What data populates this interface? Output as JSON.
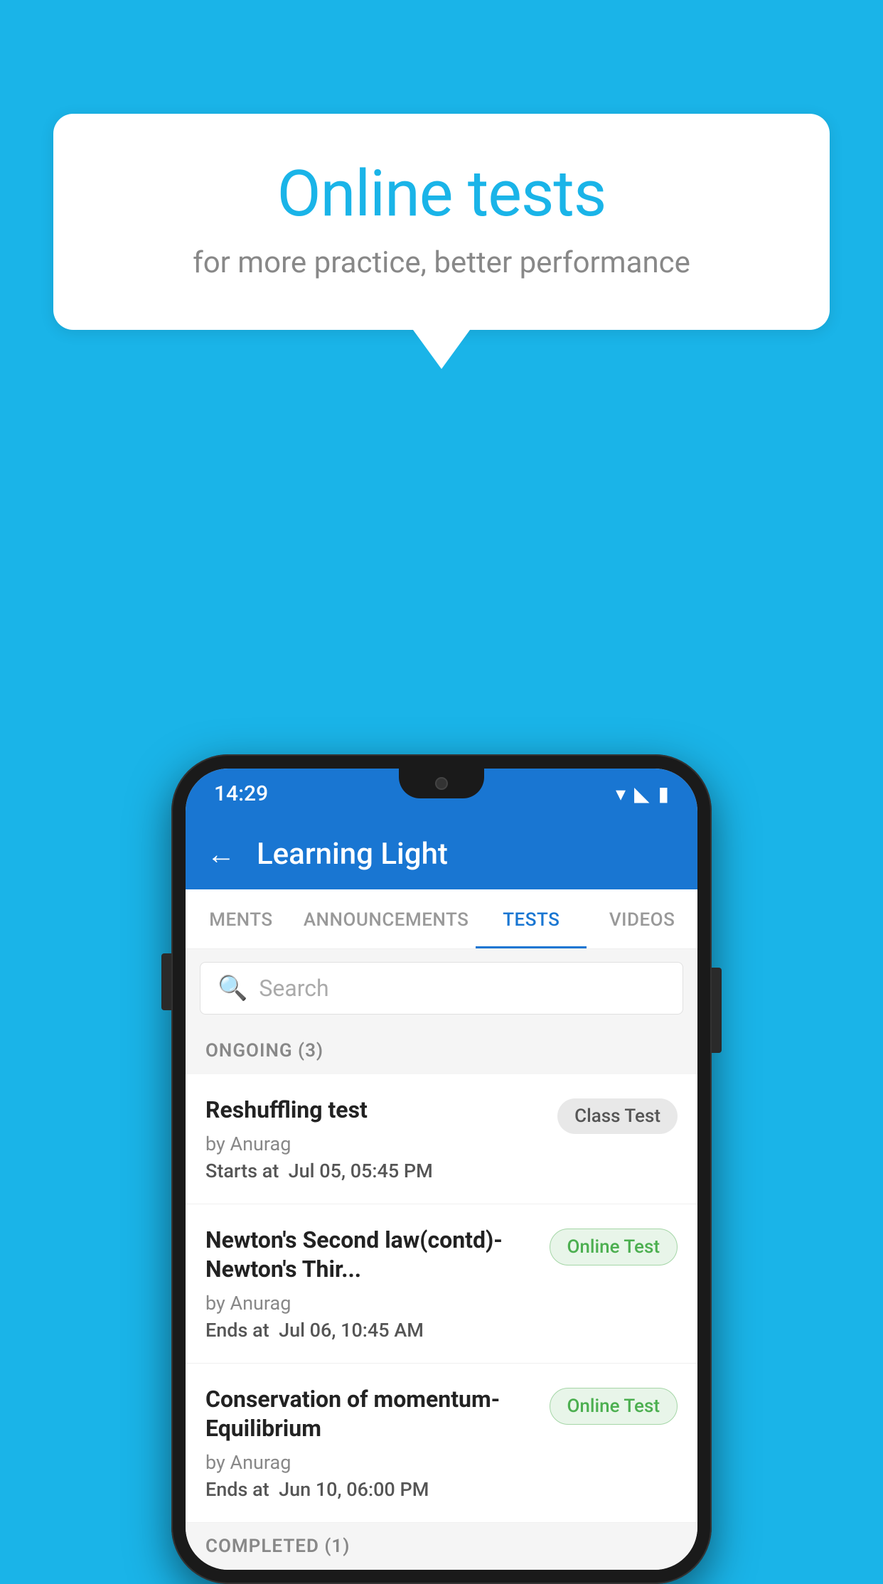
{
  "background_color": "#1ab4e8",
  "speech_bubble": {
    "title": "Online tests",
    "subtitle": "for more practice, better performance"
  },
  "phone": {
    "status_bar": {
      "time": "14:29",
      "icons": [
        "wifi",
        "signal",
        "battery"
      ]
    },
    "app_bar": {
      "back_arrow": "←",
      "title": "Learning Light"
    },
    "tabs": [
      {
        "label": "MENTS",
        "active": false
      },
      {
        "label": "ANNOUNCEMENTS",
        "active": false
      },
      {
        "label": "TESTS",
        "active": true
      },
      {
        "label": "VIDEOS",
        "active": false
      }
    ],
    "search": {
      "placeholder": "Search"
    },
    "ongoing_section": {
      "label": "ONGOING (3)",
      "items": [
        {
          "title": "Reshuffling test",
          "author": "by Anurag",
          "date_label": "Starts at",
          "date": "Jul 05, 05:45 PM",
          "badge": "Class Test",
          "badge_type": "class"
        },
        {
          "title": "Newton's Second law(contd)-Newton's Thir...",
          "author": "by Anurag",
          "date_label": "Ends at",
          "date": "Jul 06, 10:45 AM",
          "badge": "Online Test",
          "badge_type": "online"
        },
        {
          "title": "Conservation of momentum-Equilibrium",
          "author": "by Anurag",
          "date_label": "Ends at",
          "date": "Jun 10, 06:00 PM",
          "badge": "Online Test",
          "badge_type": "online"
        }
      ]
    },
    "completed_section": {
      "label": "COMPLETED (1)"
    }
  }
}
